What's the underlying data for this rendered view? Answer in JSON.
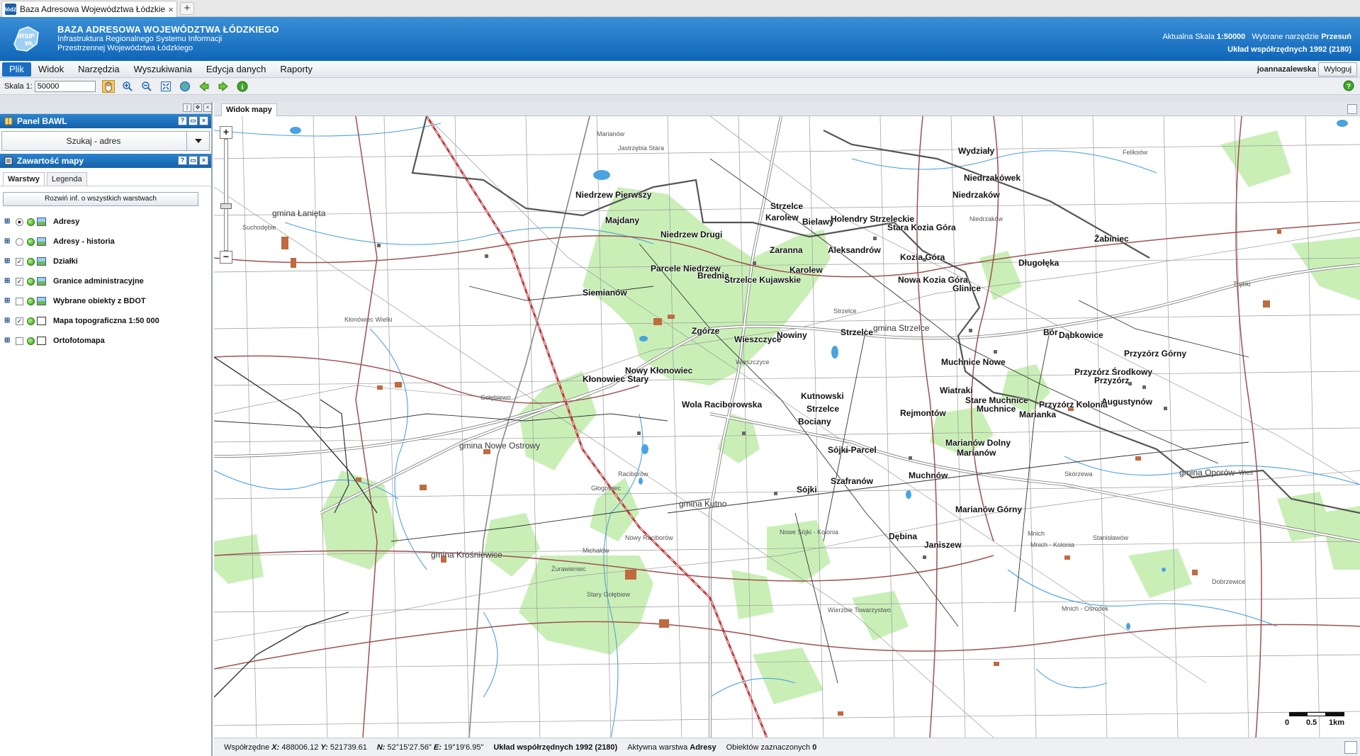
{
  "browser": {
    "tab_title": "Baza Adresowa Województwa Łódzkiego...",
    "tab_close": "×",
    "new_tab": "+",
    "favicon_text": "łódź"
  },
  "header": {
    "title": "BAZA ADRESOWA WOJEWÓDZTWA ŁÓDZKIEGO",
    "subtitle1": "Infrastruktura Regionalnego Systemu Informacji",
    "subtitle2": "Przestrzennej Województwa Łódzkiego",
    "scale_label": "Aktualna Skala",
    "scale_value": "1:50000",
    "tool_label": "Wybrane narzędzie",
    "tool_value": "Przesuń",
    "crs": "Układ współrzędnych 1992 (2180)",
    "logo_text": "IRSIP WŁ"
  },
  "menu": {
    "items": [
      "Plik",
      "Widok",
      "Narzędzia",
      "Wyszukiwania",
      "Edycja danych",
      "Raporty"
    ],
    "active": "Plik",
    "user": "joannazalewska",
    "logout": "Wyloguj"
  },
  "toolbar": {
    "scale_label": "Skala 1:",
    "scale_value": "50000",
    "tools": [
      "pan-icon",
      "zoom-in-icon",
      "zoom-out-icon",
      "zoom-extent-icon",
      "globe-icon",
      "back-icon",
      "forward-icon",
      "info-icon"
    ],
    "help": "?"
  },
  "panel_bawl": {
    "title": "Panel BAWL",
    "search_label": "Szukaj - adres"
  },
  "panel_content": {
    "title": "Zawartość mapy",
    "tabs": [
      "Warstwy",
      "Legenda"
    ],
    "active_tab": "Warstwy",
    "expand_all": "Rozwiń inf. o wszystkich warstwach",
    "layers": [
      {
        "name": "Adresy",
        "control": "radio",
        "checked": true
      },
      {
        "name": "Adresy - historia",
        "control": "radio",
        "checked": false
      },
      {
        "name": "Działki",
        "control": "checkbox",
        "checked": true
      },
      {
        "name": "Granice administracyjne",
        "control": "checkbox",
        "checked": true
      },
      {
        "name": "Wybrane obiekty z BDOT",
        "control": "checkbox",
        "checked": false
      },
      {
        "name": "Mapa topograficzna 1:50 000",
        "control": "checkbox",
        "checked": true
      },
      {
        "name": "Ortofotomapa",
        "control": "checkbox",
        "checked": false
      }
    ]
  },
  "map": {
    "tab": "Widok mapy",
    "zoom_in": "+",
    "zoom_out": "−",
    "scalebar": [
      "0",
      "0.5",
      "1km"
    ],
    "towns": [
      "Wydziały",
      "Niedrzakówek",
      "Niedrzaków",
      "Niedrzew Pierwszy",
      "Strzelce",
      "Karolew",
      "Bielawy",
      "Holendry Strzeleckie",
      "Stara Kozia Góra",
      "Majdany",
      "Niedrzew Drugi",
      "Żabiniec",
      "Zaranna",
      "Aleksandrów",
      "Kozia Góra",
      "Długołęka",
      "Karolew",
      "Parcele Niedrzew",
      "Brednia",
      "Strzelce Kujawskie",
      "Nowa Kozia Góra",
      "Glinice",
      "Siemianów",
      "Zgórze",
      "Strzelce",
      "Wieszczyce",
      "Nowiny",
      "Bór",
      "Dąbkowice",
      "Przyzórz Górny",
      "Muchnice Nowe",
      "Nowy Kłonowiec",
      "Kłonowiec Stary",
      "Przyzórz Środkowy",
      "Przyzórz",
      "Wiatraki",
      "Stare Muchnice",
      "Muchnice",
      "Przyzórz Kolonia",
      "Augustynów",
      "Rejmontów",
      "Marianka",
      "Kutnowski",
      "Strzelce",
      "Wola Raciborowska",
      "Bociany",
      "Marianów Dolny",
      "Marianów",
      "Sójki-Parcel",
      "Muchnów",
      "Szafranów",
      "Sójki",
      "Marianów Górny",
      "Dębina",
      "Janiszew"
    ],
    "gminas": [
      "gmina Łanięta",
      "gmina Strzelce",
      "gmina Nowe Ostrowy",
      "gmina Kutno",
      "gmina Oporów",
      "gmina Krośniewice"
    ],
    "small_labels": [
      "Marianów",
      "Jastrzębia Stara",
      "Feliksów",
      "Suchodębie",
      "Kłonówiec Wielki",
      "Gołębiewo",
      "Głogowiec",
      "Raciborów",
      "Nowy Raciborów",
      "Michałów",
      "Żurawieniec",
      "Stary Gołębiew",
      "Nowe Sójki - Kolonia",
      "Wierzbie Towarzystwo",
      "Skórzewa",
      "Stanisławów",
      "Mnich",
      "Mnich - Kolonia",
      "Wieś",
      "Dobrzewice",
      "Trębki",
      "Niedrzaków",
      "Strzelce",
      "Wieszczyce",
      "Mnich - Ośrodek"
    ]
  },
  "status": {
    "coords_label": "Współrzędne",
    "x": "488006.12",
    "y": "521739.61",
    "n": "52°15'27.56\"",
    "e": "19°19'6.95\"",
    "crs": "Układ współrzędnych 1992 (2180)",
    "active_layer_label": "Aktywna warstwa",
    "active_layer": "Adresy",
    "selected_label": "Obiektów zaznaczonych",
    "selected": "0"
  }
}
